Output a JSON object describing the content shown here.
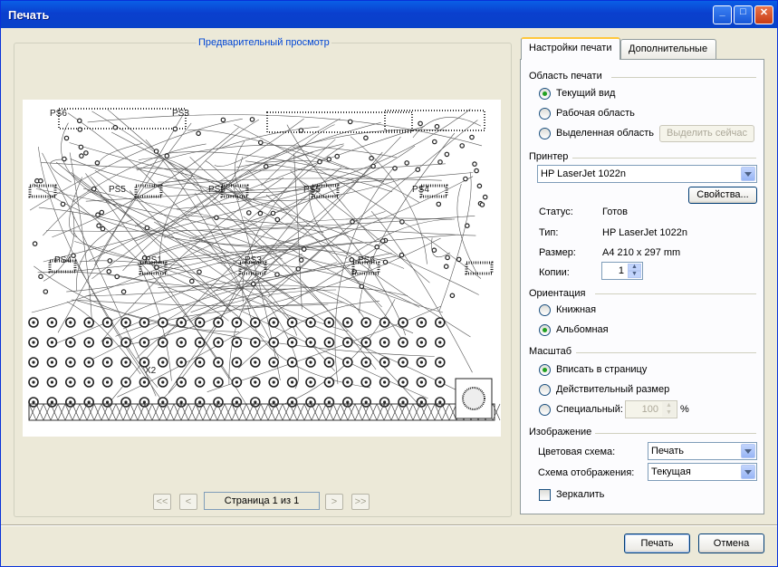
{
  "window": {
    "title": "Печать",
    "controls": {
      "minimize": "_",
      "maximize": "□",
      "close": "✕"
    }
  },
  "preview": {
    "group_label": "Предварительный просмотр",
    "pcb_labels": [
      "PS6",
      "PS5",
      "PS3",
      "PS5",
      "PS5",
      "PS4",
      "PS4",
      "PS1",
      "PS3",
      "PS6",
      "X2"
    ],
    "nav": {
      "first": "<<",
      "prev": "<",
      "page_text": "Страница 1 из 1",
      "next": ">",
      "last": ">>"
    }
  },
  "tabs": [
    "Настройки печати",
    "Дополнительные"
  ],
  "print_area": {
    "title": "Область печати",
    "options": [
      "Текущий вид",
      "Рабочая область",
      "Выделенная область"
    ],
    "selected": 0,
    "select_now": "Выделить сейчас"
  },
  "printer": {
    "title": "Принтер",
    "selected": "HP LaserJet 1022n",
    "properties": "Свойства...",
    "status_label": "Статус:",
    "status_value": "Готов",
    "type_label": "Тип:",
    "type_value": "HP LaserJet 1022n",
    "size_label": "Размер:",
    "size_value": "A4 210 x 297 mm",
    "copies_label": "Копии:",
    "copies_value": "1"
  },
  "orientation": {
    "title": "Ориентация",
    "options": [
      "Книжная",
      "Альбомная"
    ],
    "selected": 1
  },
  "scale": {
    "title": "Масштаб",
    "options": [
      "Вписать в страницу",
      "Действительный размер",
      "Специальный:"
    ],
    "selected": 0,
    "custom_value": "100",
    "percent": "%"
  },
  "image": {
    "title": "Изображение",
    "color_scheme_label": "Цветовая схема:",
    "color_scheme_value": "Печать",
    "display_scheme_label": "Схема отображения:",
    "display_scheme_value": "Текущая",
    "mirror_label": "Зеркалить"
  },
  "footer": {
    "print": "Печать",
    "cancel": "Отмена"
  },
  "colors": {
    "titlebar": "#0a3fce",
    "accent_label": "#0046d5",
    "radio_dot": "#21a121"
  }
}
